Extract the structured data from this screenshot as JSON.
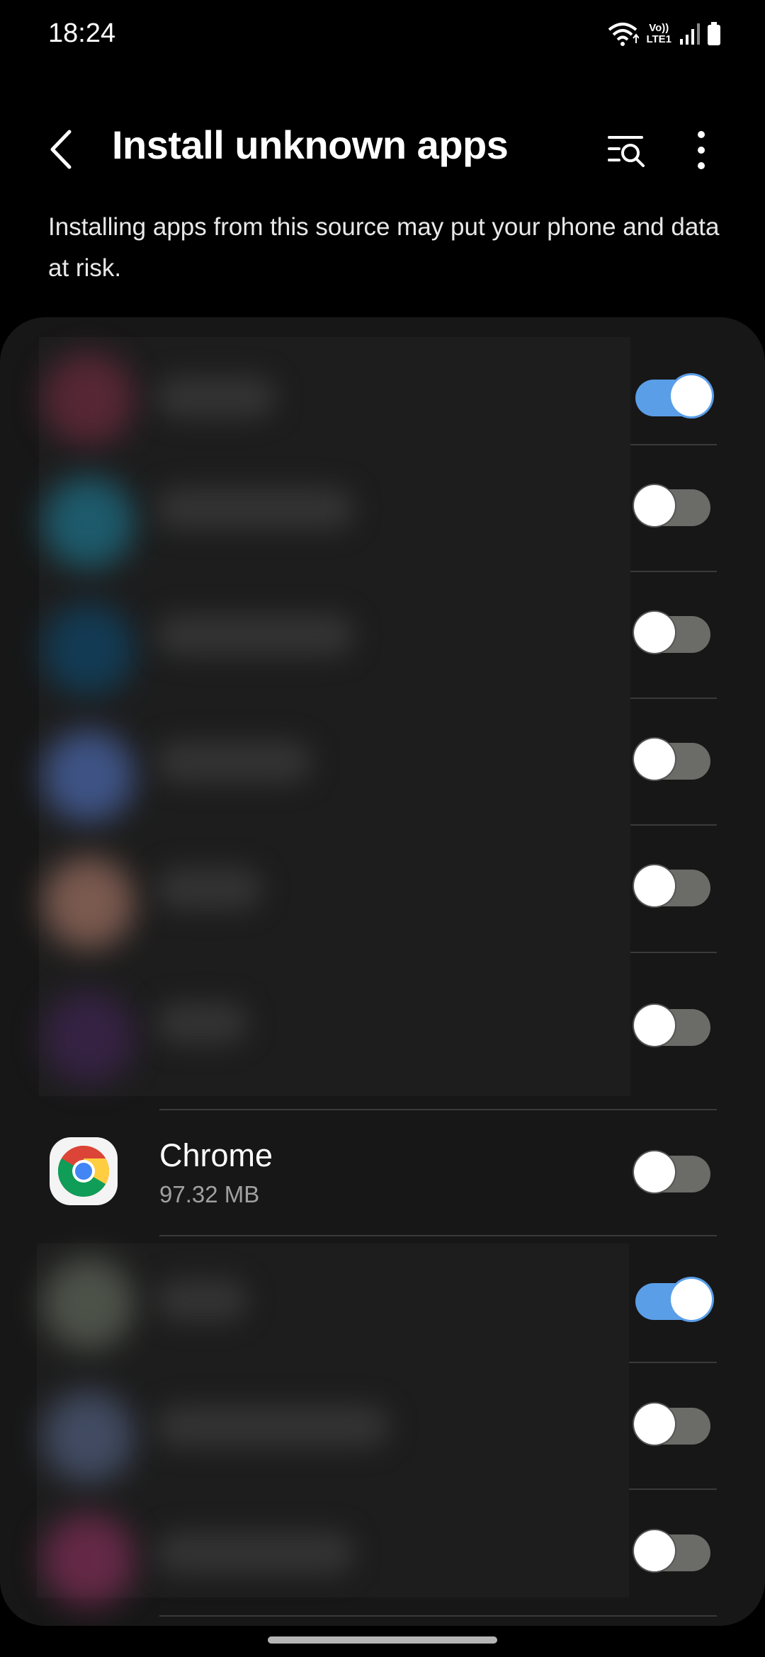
{
  "status_bar": {
    "time": "18:24",
    "volte_top": "Vo))",
    "volte_bottom": "LTE1"
  },
  "header": {
    "title": "Install unknown apps",
    "back_icon": "chevron-left-icon",
    "search_icon": "list-search-icon",
    "more_icon": "more-vert-icon"
  },
  "warning": "Installing apps from this source may put your phone and data at risk.",
  "apps": [
    {
      "name": "",
      "size": "",
      "enabled": true,
      "blurred": true
    },
    {
      "name": "",
      "size": "",
      "enabled": false,
      "blurred": true
    },
    {
      "name": "",
      "size": "",
      "enabled": false,
      "blurred": true
    },
    {
      "name": "",
      "size": "",
      "enabled": false,
      "blurred": true
    },
    {
      "name": "",
      "size": "",
      "enabled": false,
      "blurred": true
    },
    {
      "name": "",
      "size": "",
      "enabled": false,
      "blurred": true
    },
    {
      "name": "Chrome",
      "size": "97.32 MB",
      "enabled": false,
      "blurred": false
    },
    {
      "name": "",
      "size": "",
      "enabled": true,
      "blurred": true
    },
    {
      "name": "",
      "size": "",
      "enabled": false,
      "blurred": true
    },
    {
      "name": "",
      "size": "",
      "enabled": false,
      "blurred": true
    }
  ],
  "colors": {
    "toggle_on": "#5a9ee8",
    "toggle_off": "#6b6b67",
    "card_bg": "#171717"
  }
}
